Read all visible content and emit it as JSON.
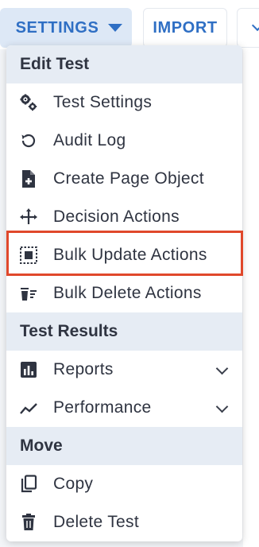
{
  "toolbar": {
    "settings_label": "SETTINGS",
    "import_label": "IMPORT"
  },
  "menu": {
    "sections": [
      {
        "title": "Edit Test",
        "items": [
          {
            "label": "Test Settings",
            "icon": "gears-icon"
          },
          {
            "label": "Audit Log",
            "icon": "history-icon"
          },
          {
            "label": "Create Page Object",
            "icon": "file-plus-icon"
          },
          {
            "label": "Decision Actions",
            "icon": "decision-arrows-icon"
          },
          {
            "label": "Bulk Update Actions",
            "icon": "select-all-icon"
          },
          {
            "label": "Bulk Delete Actions",
            "icon": "bulk-delete-icon"
          }
        ]
      },
      {
        "title": "Test Results",
        "items": [
          {
            "label": "Reports",
            "icon": "bar-chart-icon",
            "expandable": true
          },
          {
            "label": "Performance",
            "icon": "trend-line-icon",
            "expandable": true
          }
        ]
      },
      {
        "title": "Move",
        "items": [
          {
            "label": "Copy",
            "icon": "copy-icon"
          },
          {
            "label": "Delete Test",
            "icon": "trash-icon"
          }
        ]
      }
    ]
  },
  "colors": {
    "accent": "#2f6fc4",
    "section_bg": "#e6ecf4",
    "highlight_border": "#e0482b",
    "text": "#2f3441"
  }
}
